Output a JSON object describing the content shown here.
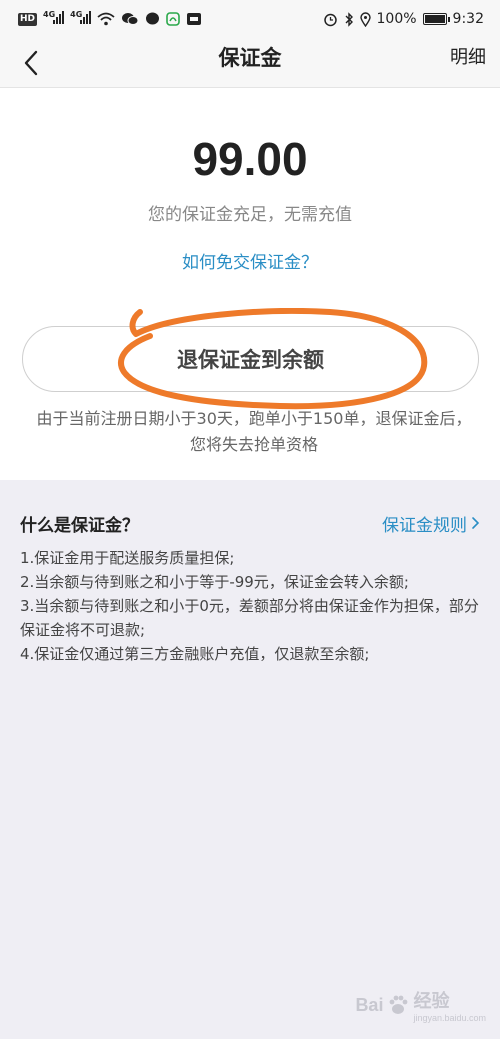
{
  "status_bar": {
    "left_badge": "HD",
    "net1": "4G",
    "net2": "4G",
    "battery_percent": "100%",
    "time": "9:32"
  },
  "nav": {
    "title": "保证金",
    "detail_label": "明细"
  },
  "deposit": {
    "amount": "99.00",
    "status_text": "您的保证金充足，无需充值",
    "how_link": "如何免交保证金？",
    "refund_button": "退保证金到余额",
    "notice": "由于当前注册日期小于30天，跑单小于150单，退保证金后，您将失去抢单资格"
  },
  "info": {
    "title": "什么是保证金？",
    "rules_link": "保证金规则",
    "rules": [
      "1.保证金用于配送服务质量担保;",
      "2.当余额与待到账之和小于等于-99元，保证金会转入余额;",
      "3.当余额与待到账之和小于0元，差额部分将由保证金作为担保，部分保证金将不可退款;",
      "4.保证金仅通过第三方金融账户充值，仅退款至余额;"
    ]
  },
  "watermark": {
    "brand": "Bai",
    "sub": "jingyan.baidu.com",
    "suffix": "经验"
  },
  "colors": {
    "link": "#2a8ec5",
    "annotation": "#ee7a2a",
    "background": "#efeef4"
  }
}
